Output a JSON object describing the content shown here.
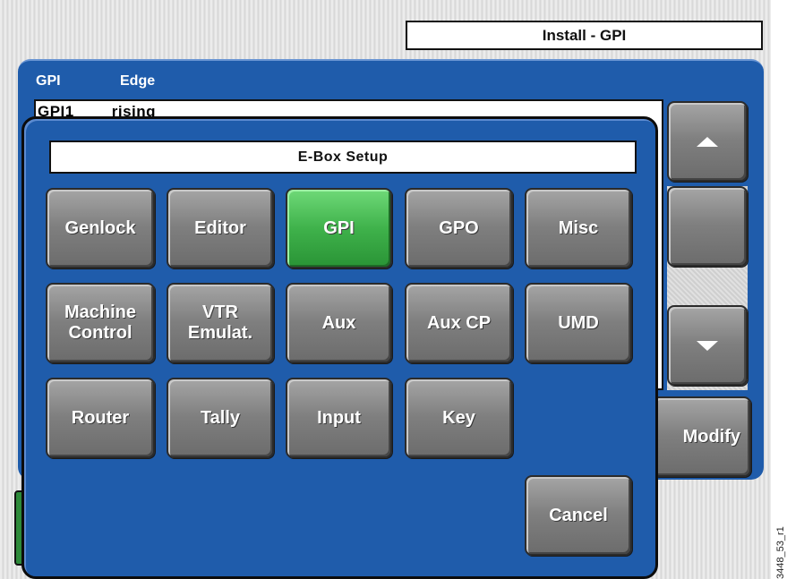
{
  "header": {
    "title": "Install - GPI"
  },
  "list": {
    "columns": [
      "GPI",
      "Edge"
    ],
    "rows": [
      {
        "gpi": "GPI1",
        "edge": "rising"
      }
    ]
  },
  "side_buttons": {
    "modify_label": "Modify"
  },
  "dialog": {
    "title": "E-Box Setup",
    "buttons": [
      {
        "label": "Genlock",
        "selected": false
      },
      {
        "label": "Editor",
        "selected": false
      },
      {
        "label": "GPI",
        "selected": true
      },
      {
        "label": "GPO",
        "selected": false
      },
      {
        "label": "Misc",
        "selected": false
      },
      {
        "label": "Machine\nControl",
        "selected": false
      },
      {
        "label": "VTR\nEmulat.",
        "selected": false
      },
      {
        "label": "Aux",
        "selected": false
      },
      {
        "label": "Aux CP",
        "selected": false
      },
      {
        "label": "UMD",
        "selected": false
      },
      {
        "label": "Router",
        "selected": false
      },
      {
        "label": "Tally",
        "selected": false
      },
      {
        "label": "Input",
        "selected": false
      },
      {
        "label": "Key",
        "selected": false
      }
    ],
    "cancel_label": "Cancel"
  },
  "figure_id": "3448_53_r1",
  "colors": {
    "panel_blue": "#1f5cab",
    "button_gray": "#7f7f7f",
    "selected_green": "#3fb24b"
  }
}
